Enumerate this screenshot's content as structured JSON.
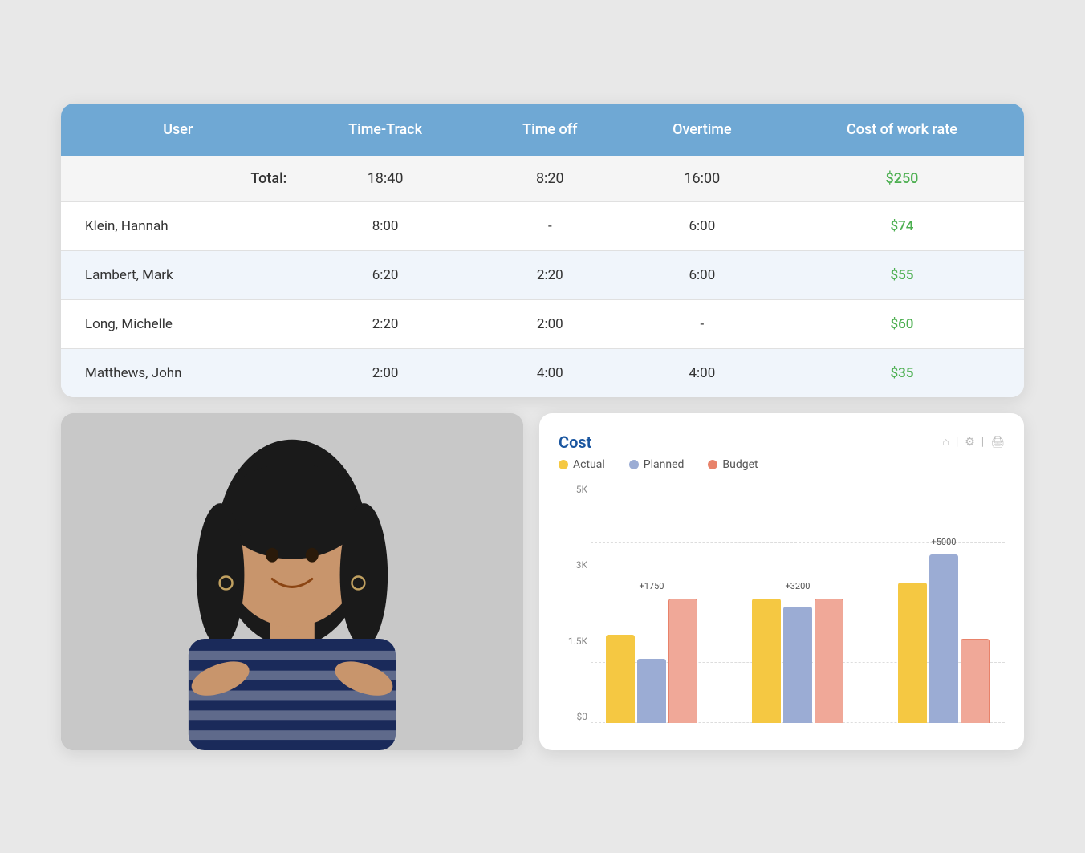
{
  "table": {
    "headers": [
      "User",
      "Time-Track",
      "Time off",
      "Overtime",
      "Cost of work rate"
    ],
    "total_row": {
      "label": "Total:",
      "time_track": "18:40",
      "time_off": "8:20",
      "overtime": "16:00",
      "cost": "$250"
    },
    "rows": [
      {
        "user": "Klein, Hannah",
        "time_track": "8:00",
        "time_off": "-",
        "overtime": "6:00",
        "cost": "$74"
      },
      {
        "user": "Lambert, Mark",
        "time_track": "6:20",
        "time_off": "2:20",
        "overtime": "6:00",
        "cost": "$55"
      },
      {
        "user": "Long, Michelle",
        "time_track": "2:20",
        "time_off": "2:00",
        "overtime": "-",
        "cost": "$60"
      },
      {
        "user": "Matthews, John",
        "time_track": "2:00",
        "time_off": "4:00",
        "overtime": "4:00",
        "cost": "$35"
      }
    ]
  },
  "chart": {
    "title": "Cost",
    "legend": [
      {
        "key": "actual",
        "label": "Actual",
        "color": "#f5c842"
      },
      {
        "key": "planned",
        "label": "Planned",
        "color": "#9bacd4"
      },
      {
        "key": "budget",
        "label": "Budget",
        "color": "#e8826a"
      }
    ],
    "y_axis": [
      "5K",
      "3K",
      "1.5K",
      "$0"
    ],
    "bars": [
      {
        "label": "+1750",
        "actual_h": 110,
        "planned_h": 80,
        "budget_h": 155
      },
      {
        "label": "+3200",
        "actual_h": 155,
        "planned_h": 145,
        "budget_h": 155
      },
      {
        "label": "+5000",
        "actual_h": 175,
        "planned_h": 210,
        "budget_h": 105
      }
    ],
    "icons": [
      "⌂",
      "⚙",
      "🖨"
    ]
  }
}
